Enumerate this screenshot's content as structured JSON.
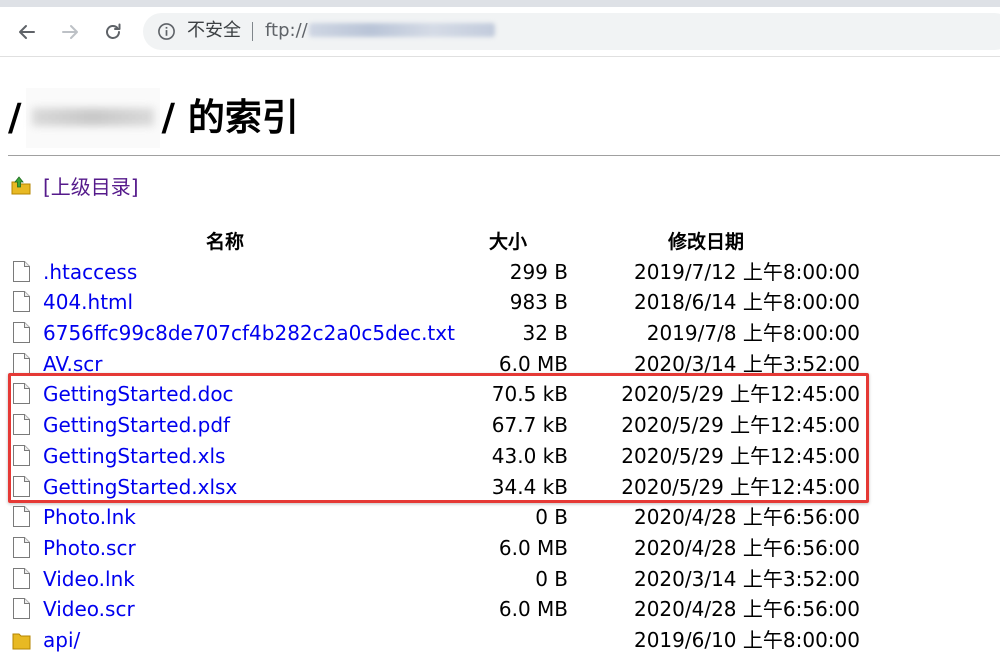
{
  "browser": {
    "security_label": "不安全",
    "url_scheme": "ftp://",
    "icons": [
      "back-arrow-icon",
      "forward-arrow-icon",
      "reload-icon",
      "info-icon"
    ]
  },
  "page": {
    "title_prefix": "/",
    "title_suffix": "/ 的索引",
    "parent_link": "[上级目录]"
  },
  "table": {
    "headers": {
      "name": "名称",
      "size": "大小",
      "date": "修改日期"
    },
    "rows": [
      {
        "name": ".htaccess",
        "size": "299 B",
        "date": "2019/7/12 上午8:00:00",
        "type": "file"
      },
      {
        "name": "404.html",
        "size": "983 B",
        "date": "2018/6/14 上午8:00:00",
        "type": "file"
      },
      {
        "name": "6756ffc99c8de707cf4b282c2a0c5dec.txt",
        "size": "32 B",
        "date": "2019/7/8 上午8:00:00",
        "type": "file"
      },
      {
        "name": "AV.scr",
        "size": "6.0 MB",
        "date": "2020/3/14 上午3:52:00",
        "type": "file"
      },
      {
        "name": "GettingStarted.doc",
        "size": "70.5 kB",
        "date": "2020/5/29 上午12:45:00",
        "type": "file"
      },
      {
        "name": "GettingStarted.pdf",
        "size": "67.7 kB",
        "date": "2020/5/29 上午12:45:00",
        "type": "file"
      },
      {
        "name": "GettingStarted.xls",
        "size": "43.0 kB",
        "date": "2020/5/29 上午12:45:00",
        "type": "file"
      },
      {
        "name": "GettingStarted.xlsx",
        "size": "34.4 kB",
        "date": "2020/5/29 上午12:45:00",
        "type": "file"
      },
      {
        "name": "Photo.lnk",
        "size": "0 B",
        "date": "2020/4/28 上午6:56:00",
        "type": "file"
      },
      {
        "name": "Photo.scr",
        "size": "6.0 MB",
        "date": "2020/4/28 上午6:56:00",
        "type": "file"
      },
      {
        "name": "Video.lnk",
        "size": "0 B",
        "date": "2020/3/14 上午3:52:00",
        "type": "file"
      },
      {
        "name": "Video.scr",
        "size": "6.0 MB",
        "date": "2020/4/28 上午6:56:00",
        "type": "file"
      },
      {
        "name": "api/",
        "size": "",
        "date": "2019/6/10 上午8:00:00",
        "type": "folder"
      }
    ]
  },
  "colors": {
    "link": "#0000ee",
    "visited_link": "#551a8b",
    "highlight": "#e53935"
  }
}
